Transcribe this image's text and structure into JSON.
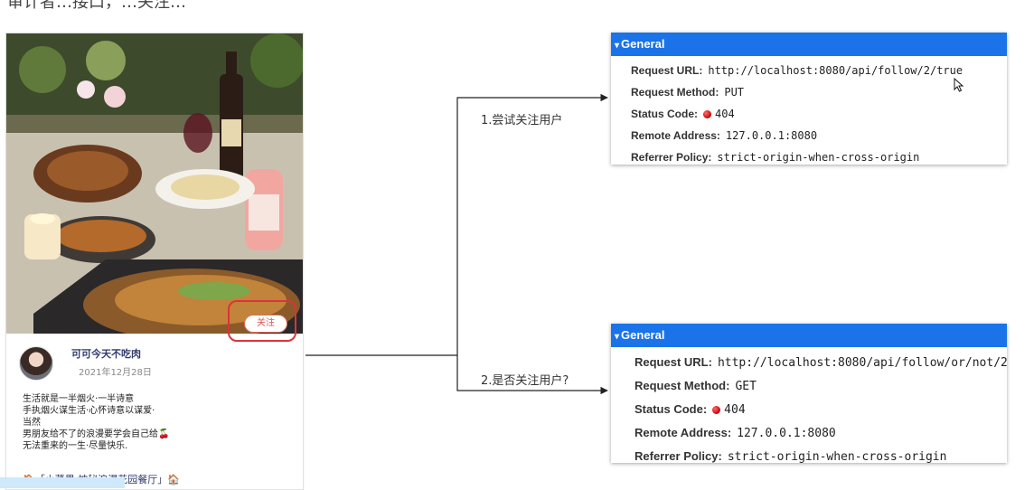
{
  "top_caption": "审计者…接口，…关注…",
  "card": {
    "author_name": "可可今天不吃肉",
    "post_date": "2021年12月28日",
    "follow_label": "关注",
    "post_lines": [
      "生活就是一半烟火·一半诗意",
      "手执烟火谋生活·心怀诗意以谋爱·",
      "当然",
      "男朋友给不了的浪漫要学会自己给🍒",
      "无法重来的一生·尽量快乐."
    ],
    "place_tag": "🏠「小菜果·神秘浪漫花园餐厅」🏠"
  },
  "steps": {
    "step1": "1.尝试关注用户",
    "step2": "2.是否关注用户?"
  },
  "panels": {
    "top": {
      "header": "General",
      "caret": "▾",
      "request_url_key": "Request URL:",
      "request_url": "http://localhost:8080/api/follow/2/true",
      "method_key": "Request Method:",
      "method": "PUT",
      "status_key": "Status Code:",
      "status": "404",
      "remote_key": "Remote Address:",
      "remote": "127.0.0.1:8080",
      "referrer_key": "Referrer Policy:",
      "referrer": "strict-origin-when-cross-origin"
    },
    "bottom": {
      "header": "General",
      "caret": "▾",
      "request_url_key": "Request URL:",
      "request_url": "http://localhost:8080/api/follow/or/not/2",
      "method_key": "Request Method:",
      "method": "GET",
      "status_key": "Status Code:",
      "status": "404",
      "remote_key": "Remote Address:",
      "remote": "127.0.0.1:8080",
      "referrer_key": "Referrer Policy:",
      "referrer": "strict-origin-when-cross-origin"
    }
  },
  "colors": {
    "header_blue": "#1a73e8",
    "highlight_red": "#d9343b",
    "status_red": "#d00000"
  }
}
